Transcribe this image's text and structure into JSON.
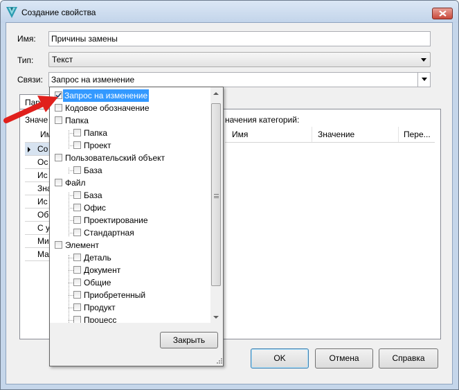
{
  "window": {
    "title": "Создание свойства",
    "close_glyph": "✕"
  },
  "form": {
    "name_label": "Имя:",
    "name_value": "Причины замены",
    "type_label": "Тип:",
    "type_value": "Текст",
    "links_label": "Связи:",
    "links_value": "Запрос на изменение"
  },
  "tabs": {
    "first_tab_partial": "Пар"
  },
  "panel": {
    "left_caption_partial": "Значе",
    "right_caption": "начения категорий:",
    "right_grid_columns": [
      "Имя",
      "Значение",
      "Пере..."
    ],
    "left_grid_header_partial": "Им",
    "left_grid_rows": [
      "Со",
      "Ос",
      "Ис",
      "Зна",
      "Ис",
      "Об",
      "С у",
      "Ми",
      "Ма"
    ]
  },
  "buttons": {
    "ok": "OK",
    "cancel": "Отмена",
    "help": "Справка"
  },
  "popup": {
    "close_label": "Закрыть",
    "nodes": [
      {
        "label": "Запрос на изменение",
        "checked": true,
        "level": 0
      },
      {
        "label": "Кодовое обозначение",
        "checked": false,
        "level": 0
      },
      {
        "label": "Папка",
        "checked": false,
        "level": 0
      },
      {
        "label": "Папка",
        "checked": false,
        "level": 1
      },
      {
        "label": "Проект",
        "checked": false,
        "level": 1
      },
      {
        "label": "Пользовательский объект",
        "checked": false,
        "level": 0
      },
      {
        "label": "База",
        "checked": false,
        "level": 1
      },
      {
        "label": "Файл",
        "checked": false,
        "level": 0
      },
      {
        "label": "База",
        "checked": false,
        "level": 1
      },
      {
        "label": "Офис",
        "checked": false,
        "level": 1
      },
      {
        "label": "Проектирование",
        "checked": false,
        "level": 1
      },
      {
        "label": "Стандартная",
        "checked": false,
        "level": 1
      },
      {
        "label": "Элемент",
        "checked": false,
        "level": 0
      },
      {
        "label": "Деталь",
        "checked": false,
        "level": 1
      },
      {
        "label": "Документ",
        "checked": false,
        "level": 1
      },
      {
        "label": "Общие",
        "checked": false,
        "level": 1
      },
      {
        "label": "Приобретенный",
        "checked": false,
        "level": 1
      },
      {
        "label": "Продукт",
        "checked": false,
        "level": 1
      },
      {
        "label": "Процесс",
        "checked": false,
        "level": 1
      }
    ]
  },
  "colors": {
    "selection": "#3399ff",
    "annotation_arrow": "#e0201c",
    "titlebar": "#c5d6ea"
  }
}
